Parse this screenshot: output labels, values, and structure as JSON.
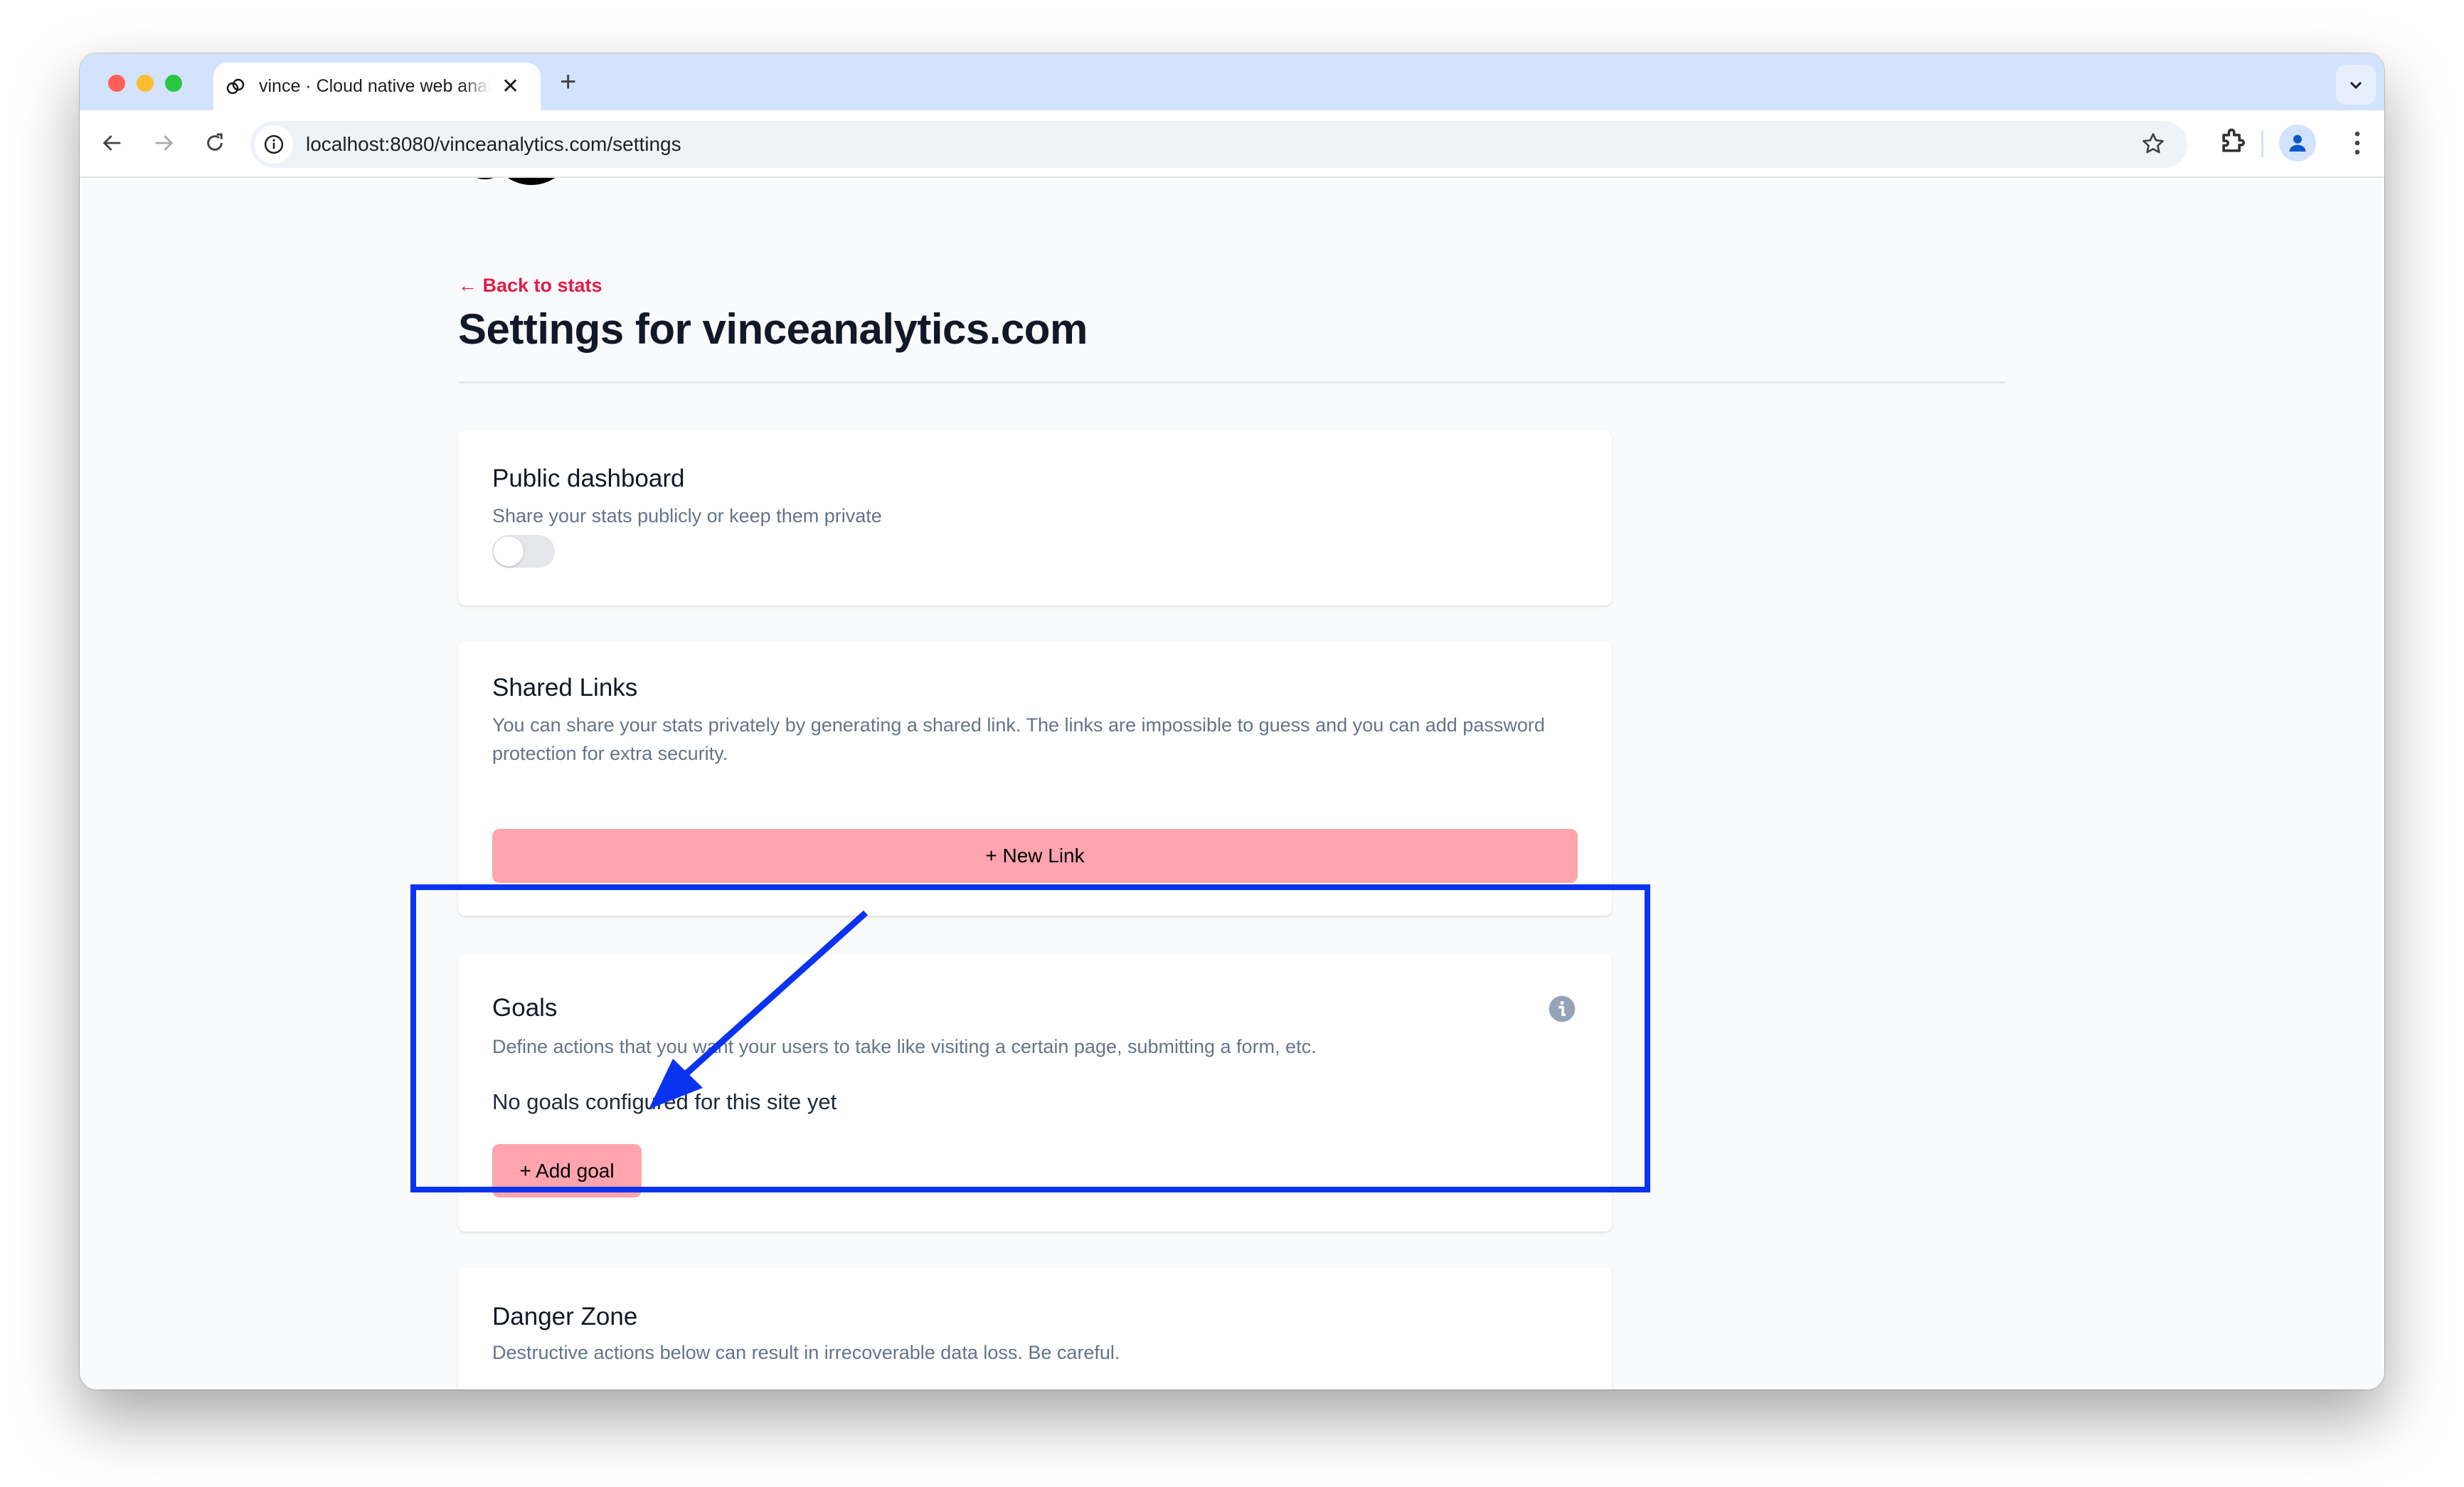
{
  "browser": {
    "tab": {
      "title": "vince · Cloud native web analytics",
      "favicon": "vince-logo-icon",
      "close_icon": "close-icon"
    },
    "new_tab_icon": "plus-icon",
    "tab_menu_icon": "chevron-down-icon",
    "nav": {
      "back_icon": "arrow-left-icon",
      "forward_icon": "arrow-right-icon",
      "reload_icon": "reload-icon"
    },
    "address_bar": {
      "site_info_icon": "info-icon",
      "url": "localhost:8080/vinceanalytics.com/settings",
      "bookmark_icon": "star-icon"
    },
    "toolbar_icons": [
      "extensions-icon",
      "profile-icon",
      "kebab-menu-icon"
    ]
  },
  "page": {
    "back_link": "← Back to stats",
    "title": "Settings for vinceanalytics.com",
    "sections": {
      "public_dashboard": {
        "title": "Public dashboard",
        "description": "Share your stats publicly or keep them private",
        "toggle_enabled": false
      },
      "shared_links": {
        "title": "Shared Links",
        "description": "You can share your stats privately by generating a shared link. The links are impossible to guess and you can add password protection for extra security.",
        "new_link_button": "+ New Link"
      },
      "goals": {
        "title": "Goals",
        "description": "Define actions that you want your users to take like visiting a certain page, submitting a form, etc.",
        "empty_message": "No goals configured for this site yet",
        "add_goal_button": "+ Add goal",
        "info_icon": "info-circle-icon"
      },
      "danger_zone": {
        "title": "Danger Zone",
        "description": "Destructive actions below can result in irrecoverable data loss. Be careful."
      }
    }
  },
  "colors": {
    "accent": "#e11d48",
    "button_pink": "#fda4af",
    "annotation_blue": "#0a33f0",
    "tabbar": "#d3e3fd"
  }
}
